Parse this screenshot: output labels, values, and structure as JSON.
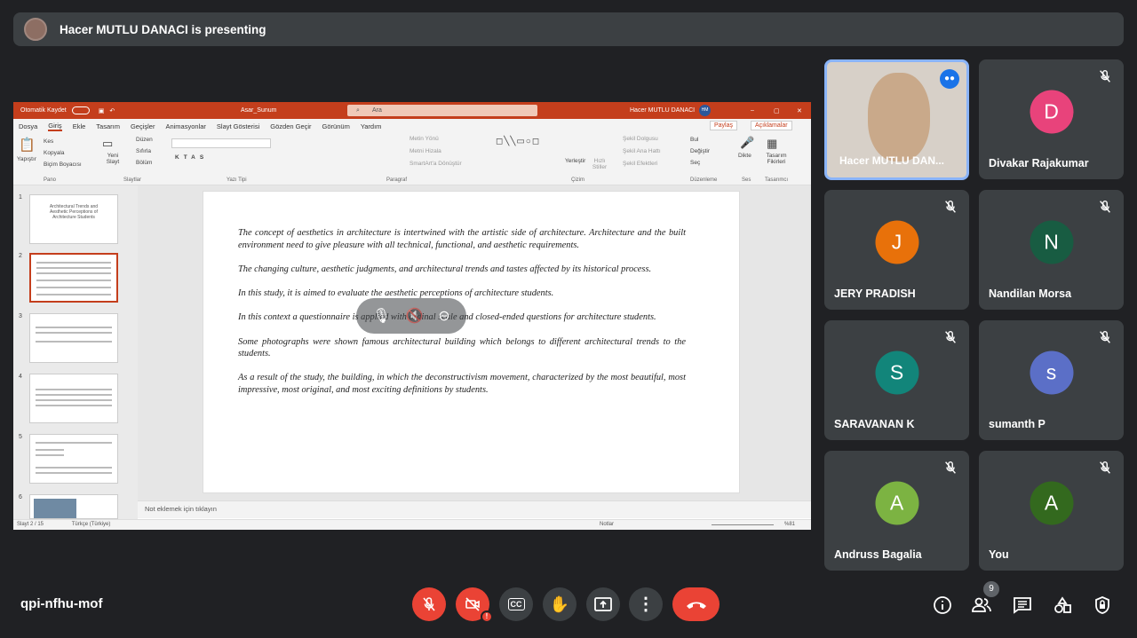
{
  "presenting": {
    "text": "Hacer MUTLU DANACI is presenting"
  },
  "ppt": {
    "autosave": "Otomatik Kaydet",
    "filename": "Asar_Sunum",
    "search_placeholder": "Ara",
    "user": "Hacer MUTLU DANACI",
    "user_initials": "HM",
    "tabs": [
      "Dosya",
      "Giriş",
      "Ekle",
      "Tasarım",
      "Geçişler",
      "Animasyonlar",
      "Slayt Gösterisi",
      "Gözden Geçir",
      "Görünüm",
      "Yardım"
    ],
    "share_btn": "Paylaş",
    "comments_btn": "Açıklamalar",
    "ribbon": {
      "paste": "Yapıştır",
      "cut": "Kes",
      "copy": "Kopyala",
      "format_painter": "Biçim Boyacısı",
      "new_slide": "Yeni Slayt",
      "layout": "Düzen",
      "reset": "Sıfırla",
      "section": "Bölüm",
      "text_direction": "Metin Yönü",
      "align_text": "Metni Hizala",
      "smartart": "SmartArt'a Dönüştür",
      "arrange": "Yerleştir",
      "quick_styles": "Hızlı Stiller",
      "shape_fill": "Şekil Dolgusu",
      "shape_outline": "Şekil Ana Hattı",
      "shape_effects": "Şekil Efektleri",
      "find": "Bul",
      "replace": "Değiştir",
      "select": "Seç",
      "dictate": "Dikte",
      "designer": "Tasarım Fikirleri",
      "groups": [
        "Pano",
        "Slaytlar",
        "Yazı Tipi",
        "Paragraf",
        "Çizim",
        "Düzenleme",
        "Ses",
        "Tasarımcı"
      ]
    },
    "slide1_title": "Architectural Trends and Aesthetic Perceptions of Architecture Students",
    "slide_paragraphs": [
      "The concept of aesthetics in architecture is intertwined with the artistic side of architecture. Architecture and the built environment need to give pleasure with all technical, functional, and aesthetic requirements.",
      "The changing culture, aesthetic judgments, and architectural trends and tastes affected by its historical process.",
      "In this study, it is aimed to evaluate the aesthetic perceptions of architecture students.",
      "In this context a questionnaire is applied with ordinal scale and closed-ended questions for architecture students.",
      "Some photographs were shown famous architectural building which belongs to different architectural trends to the students.",
      "As a result of the study, the building, in which the deconstructivism movement, characterized by the most beautiful, most impressive, most original, and most exciting definitions by students."
    ],
    "slide_numbers": [
      "1",
      "2",
      "3",
      "4",
      "5",
      "6"
    ],
    "notes": "Not eklemek için tıklayın",
    "status_slide": "Slayt 2 / 15",
    "status_lang": "Türkçe (Türkiye)",
    "status_notes": "Notlar",
    "zoom": "%81"
  },
  "participants": [
    {
      "name": "Hacer MUTLU DAN...",
      "initial": "",
      "color": ""
    },
    {
      "name": "Divakar Rajakumar",
      "initial": "D",
      "color": "#e8437b"
    },
    {
      "name": "JERY PRADISH",
      "initial": "J",
      "color": "#e8710a"
    },
    {
      "name": "Nandilan Morsa",
      "initial": "N",
      "color": "#185c42"
    },
    {
      "name": "SARAVANAN K",
      "initial": "S",
      "color": "#12857a"
    },
    {
      "name": "sumanth P",
      "initial": "s",
      "color": "#5b6fc7"
    },
    {
      "name": "Andruss Bagalia",
      "initial": "A",
      "color": "#7cb342"
    },
    {
      "name": "You",
      "initial": "A",
      "color": "#33691e"
    }
  ],
  "meeting_code": "qpi-nfhu-mof",
  "people_count": "9"
}
